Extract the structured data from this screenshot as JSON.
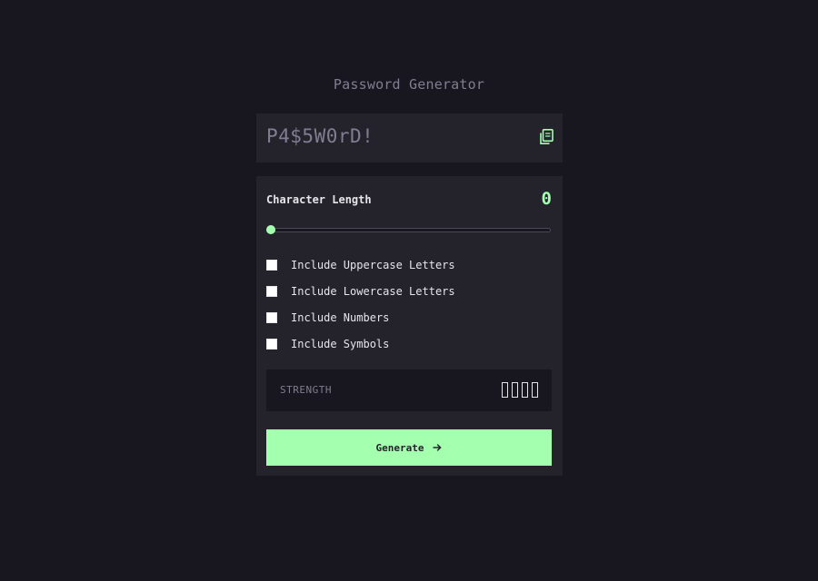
{
  "app": {
    "title": "Password Generator"
  },
  "password": {
    "value": "P4$5W0rD!",
    "copy_icon": "copy-icon"
  },
  "length": {
    "label": "Character Length",
    "value": "0",
    "slider_fraction": 0
  },
  "options": [
    {
      "label": "Include Uppercase Letters",
      "checked": false
    },
    {
      "label": "Include Lowercase Letters",
      "checked": false
    },
    {
      "label": "Include Numbers",
      "checked": false
    },
    {
      "label": "Include Symbols",
      "checked": false
    }
  ],
  "strength": {
    "label": "STRENGTH",
    "bars_total": 4,
    "bars_filled": 0
  },
  "generate": {
    "label": "Generate",
    "icon": "arrow-right-icon"
  },
  "colors": {
    "background": "#18171f",
    "panel": "#24232c",
    "accent": "#a4ffaf",
    "muted": "#817d92",
    "text": "#e6e5ea"
  }
}
